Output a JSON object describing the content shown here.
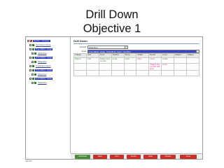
{
  "slide": {
    "title_line1": "Drill Down",
    "title_line2": "Objective 1"
  },
  "tree": {
    "items": [
      {
        "label": "System manager",
        "style": "sel",
        "icon_color": "#c0392b"
      },
      {
        "label": "Curriculum Area",
        "style": "plain",
        "icon_color": "#2e7d32"
      },
      {
        "label": "Foundation stage",
        "style": "sel",
        "icon_color": "#2e7d32"
      },
      {
        "label": "Objective",
        "style": "plain",
        "icon_color": "#2e7d32"
      },
      {
        "label": "Foundation stage",
        "style": "sel",
        "icon_color": "#2e7d32"
      },
      {
        "label": "Objective",
        "style": "plain",
        "icon_color": "#2e7d32"
      },
      {
        "label": "Curriculum Area",
        "style": "plain",
        "icon_color": "#2e7d32"
      },
      {
        "label": "Foundation stage",
        "style": "sel",
        "icon_color": "#2e7d32"
      },
      {
        "label": "Objective",
        "style": "plain",
        "icon_color": "#2e7d32"
      },
      {
        "label": "Foundation stage",
        "style": "sel",
        "icon_color": "#2e7d32"
      },
      {
        "label": "Objective",
        "style": "plain",
        "icon_color": "#2e7d32"
      }
    ]
  },
  "panel": {
    "header": "Drill Down",
    "filter1_label": "Criteria",
    "filter1_value": "Objective",
    "filter2_label": "Area",
    "filter2_value": "Foundation stage: Individual / team / Number"
  },
  "table": {
    "headers": [
      "Criteria",
      "Year",
      "Level",
      "Teacher",
      "Score",
      "Grade",
      "Result",
      "Level",
      "Subject",
      "Subject"
    ],
    "rows": [
      {
        "cells": [
          "Subject",
          "Year",
          "Subject and number",
          "Level",
          "Level",
          "Area",
          "Level",
          "Grade",
          "",
          ""
        ],
        "pink": [
          5,
          6
        ]
      },
      {
        "cells": [
          "",
          "",
          "",
          "",
          "",
          "",
          "Subject and number and level",
          "Level",
          "",
          ""
        ],
        "pink": [
          6,
          7
        ]
      },
      {
        "cells": [
          "",
          "",
          "",
          "",
          "",
          "",
          "",
          "",
          "",
          ""
        ],
        "pink": []
      }
    ]
  },
  "toolbar": {
    "buttons": [
      {
        "label": "Drill Down",
        "color": "green"
      },
      {
        "label": "Back",
        "color": "red"
      },
      {
        "label": "Print",
        "color": "red"
      },
      {
        "label": "Export",
        "color": "red"
      },
      {
        "label": "Chart",
        "color": "red"
      },
      {
        "label": "Options",
        "color": "red"
      },
      {
        "label": "Close",
        "color": "red"
      }
    ]
  },
  "footer": {
    "text": "Version"
  },
  "colors": {
    "accent_blue": "#3344cc",
    "button_red": "#c8302a",
    "button_green": "#4a8a3a",
    "text_green": "#2e8b2e",
    "text_pink": "#d0208a"
  }
}
